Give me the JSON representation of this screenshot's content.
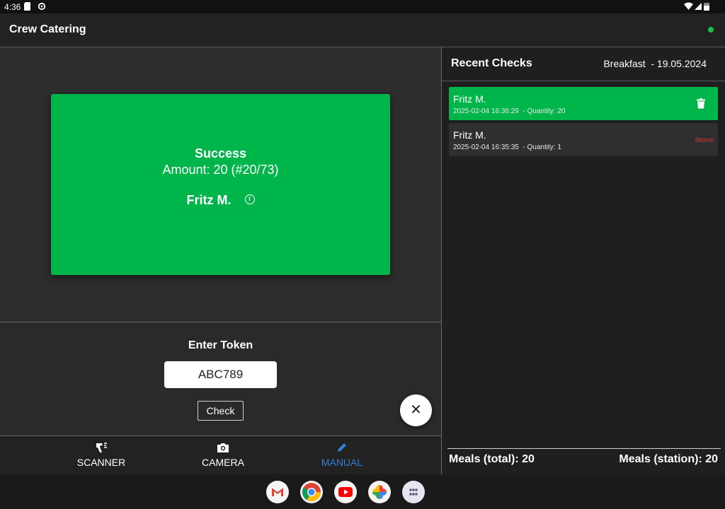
{
  "status_bar": {
    "time": "4:36"
  },
  "app": {
    "title": "Crew Catering",
    "status_color": "#1fbf4a"
  },
  "result": {
    "title": "Success",
    "amount": "Amount: 20 (#20/73)",
    "name": "Fritz M.",
    "color": "#00b64a"
  },
  "token": {
    "label": "Enter Token",
    "value": "ABC789",
    "check_label": "Check"
  },
  "nav": {
    "items": [
      {
        "label": "SCANNER",
        "icon": "barcode-scanner-icon"
      },
      {
        "label": "CAMERA",
        "icon": "camera-icon"
      },
      {
        "label": "MANUAL",
        "icon": "pencil-icon"
      }
    ],
    "active_index": 2,
    "active_color": "#2f7fd6"
  },
  "recent": {
    "title": "Recent Checks",
    "meal": "Breakfast  - 19.05.2024",
    "items": [
      {
        "name": "Fritz M.",
        "meta": "2025-02-04 16:36:29  - Quantity: 20",
        "action": "trash-icon"
      },
      {
        "name": "Fritz M.",
        "meta": "2025-02-04 16:35:35  - Quantity: 1",
        "action_label": "Storno"
      }
    ],
    "storno_color": "#e53935",
    "active_color": "#00b64a"
  },
  "totals": {
    "total": "Meals (total): 20",
    "station": "Meals (station): 20"
  },
  "dock": {
    "apps": [
      "gmail-icon",
      "chrome-icon",
      "youtube-icon",
      "photos-icon",
      "app-drawer-icon"
    ]
  }
}
